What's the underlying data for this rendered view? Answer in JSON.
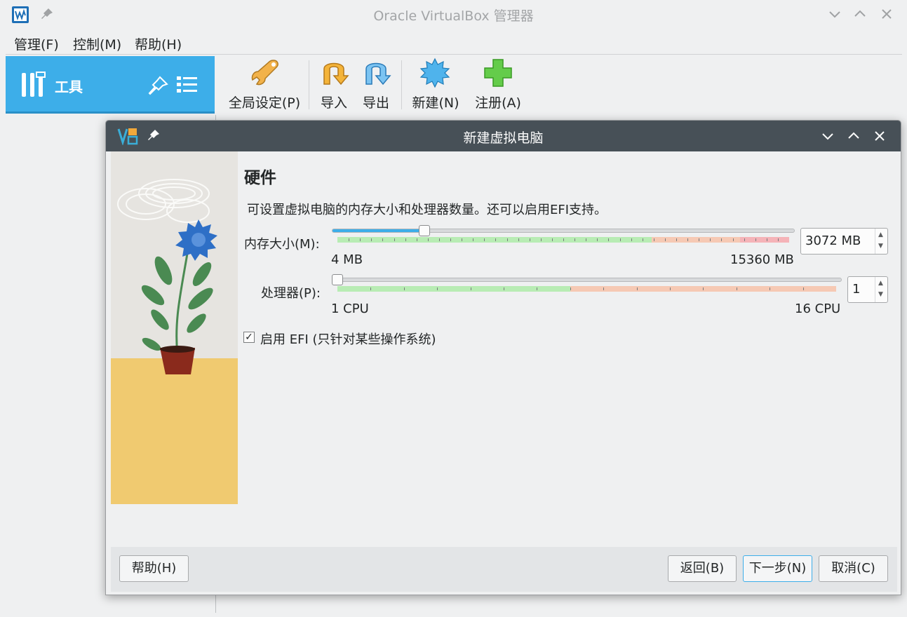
{
  "window": {
    "title": "Oracle VirtualBox 管理器"
  },
  "menu": [
    "管理(F)",
    "控制(M)",
    "帮助(H)"
  ],
  "tools_panel": {
    "label": "工具"
  },
  "toolbar": {
    "global_settings": "全局设定(P)",
    "import": "导入",
    "export": "导出",
    "new": "新建(N)",
    "register": "注册(A)"
  },
  "dialog": {
    "title": "新建虚拟电脑",
    "heading": "硬件",
    "description": "可设置虚拟电脑的内存大小和处理器数量。还可以启用EFI支持。",
    "memory": {
      "label": "内存大小(M):",
      "min_label": "4 MB",
      "max_label": "15360 MB",
      "value": "3072 MB",
      "value_mb": 3072,
      "min_mb": 4,
      "max_mb": 15360
    },
    "processor": {
      "label": "处理器(P):",
      "min_label": "1 CPU",
      "max_label": "16 CPU",
      "value": "1",
      "value_cpu": 1,
      "min_cpu": 1,
      "max_cpu": 16
    },
    "efi_checkbox": {
      "label": "启用 EFI (只针对某些操作系统)",
      "checked": true
    },
    "buttons": {
      "help": "帮助(H)",
      "back": "返回(B)",
      "next": "下一步(N)",
      "cancel": "取消(C)"
    }
  },
  "colors": {
    "accent": "#3daee9",
    "dialog_title_bg": "#475057",
    "slider_green": "#b8ecb4",
    "slider_orange": "#f6c9b4",
    "slider_red": "#f5b3b8"
  }
}
